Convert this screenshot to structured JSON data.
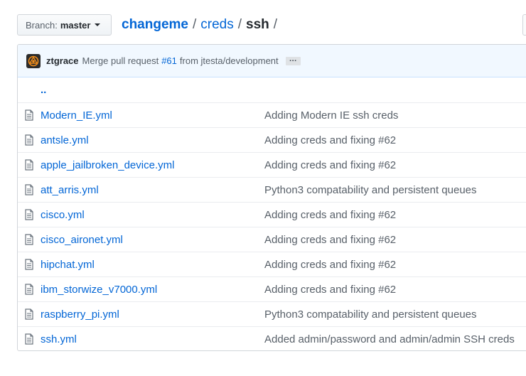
{
  "branch": {
    "label": "Branch:",
    "value": "master"
  },
  "breadcrumb": {
    "root": "changeme",
    "sep1": "/",
    "dir": "creds",
    "sep2": "/",
    "current": "ssh",
    "sep3": "/"
  },
  "commit": {
    "author": "ztgrace",
    "message_prefix": "Merge pull request",
    "pr_number": "#61",
    "message_suffix": "from jtesta/development",
    "ellipsis": "…"
  },
  "parent_dir": "..",
  "files": [
    {
      "name": "Modern_IE.yml",
      "message": "Adding Modern IE ssh creds"
    },
    {
      "name": "antsle.yml",
      "message": "Adding creds and fixing #62"
    },
    {
      "name": "apple_jailbroken_device.yml",
      "message": "Adding creds and fixing #62"
    },
    {
      "name": "att_arris.yml",
      "message": "Python3 compatability and persistent queues"
    },
    {
      "name": "cisco.yml",
      "message": "Adding creds and fixing #62"
    },
    {
      "name": "cisco_aironet.yml",
      "message": "Adding creds and fixing #62"
    },
    {
      "name": "hipchat.yml",
      "message": "Adding creds and fixing #62"
    },
    {
      "name": "ibm_storwize_v7000.yml",
      "message": "Adding creds and fixing #62"
    },
    {
      "name": "raspberry_pi.yml",
      "message": "Python3 compatability and persistent queues"
    },
    {
      "name": "ssh.yml",
      "message": "Added admin/password and admin/admin SSH creds"
    }
  ],
  "colors": {
    "link": "#0366d6",
    "muted": "#586069",
    "commit_bg": "#f1f8ff"
  },
  "icons": {
    "file": "file-text-icon",
    "caret": "caret-down-icon",
    "avatar": "user-avatar"
  }
}
